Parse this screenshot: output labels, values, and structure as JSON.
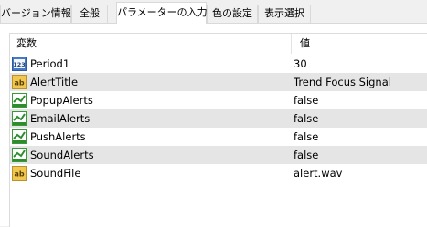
{
  "tabs": [
    {
      "label": "バージョン情報"
    },
    {
      "label": "全般"
    },
    {
      "label": "パラメーターの入力"
    },
    {
      "label": "色の設定"
    },
    {
      "label": "表示選択"
    }
  ],
  "active_tab": 2,
  "grid": {
    "headers": {
      "name": "変数",
      "value": "値"
    },
    "rows": [
      {
        "name": "Period1",
        "value": "30",
        "icon": "integer-type-icon"
      },
      {
        "name": "AlertTitle",
        "value": "Trend Focus Signal",
        "icon": "string-type-icon"
      },
      {
        "name": "PopupAlerts",
        "value": "false",
        "icon": "boolean-type-icon"
      },
      {
        "name": "EmailAlerts",
        "value": "false",
        "icon": "boolean-type-icon"
      },
      {
        "name": "PushAlerts",
        "value": "false",
        "icon": "boolean-type-icon"
      },
      {
        "name": "SoundAlerts",
        "value": "false",
        "icon": "boolean-type-icon"
      },
      {
        "name": "SoundFile",
        "value": "alert.wav",
        "icon": "string-type-icon"
      }
    ]
  }
}
